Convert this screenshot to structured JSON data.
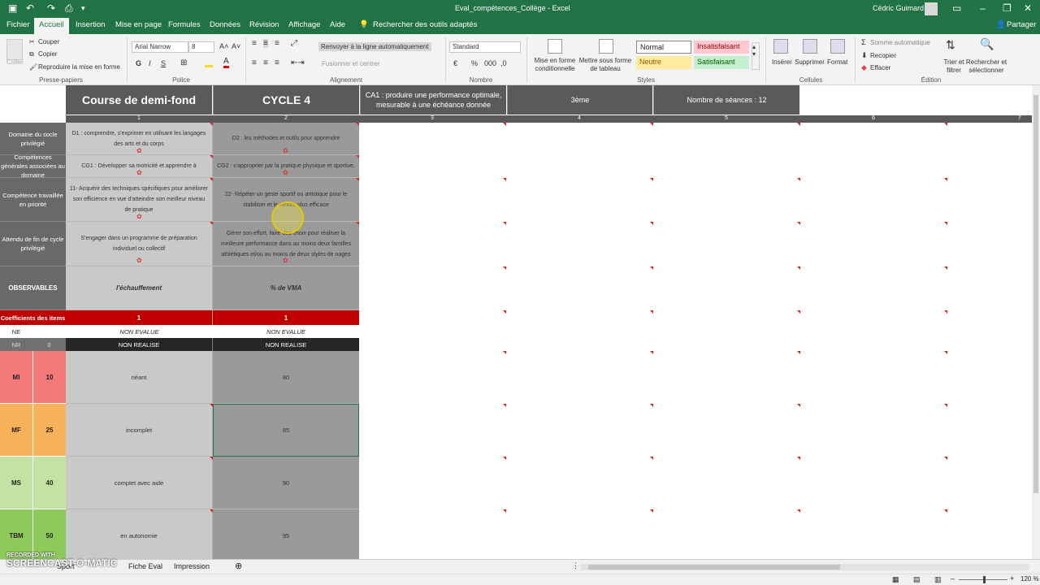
{
  "window": {
    "title": "Eval_compétences_Collège - Excel",
    "user": "Cédric Guimard"
  },
  "tabs": [
    "Fichier",
    "Accueil",
    "Insertion",
    "Mise en page",
    "Formules",
    "Données",
    "Révision",
    "Affichage",
    "Aide"
  ],
  "tell_me": "Rechercher des outils adaptés",
  "share": "Partager",
  "ribbon": {
    "clipboard": {
      "cut": "Couper",
      "copy": "Copier",
      "paste": "Coller",
      "format_painter": "Reproduire la mise en forme",
      "label": "Presse-papiers"
    },
    "font": {
      "name": "Arial Narrow",
      "size": "8",
      "bold": "G",
      "italic": "I",
      "underline": "S",
      "label": "Police"
    },
    "alignment": {
      "wrap": "Renvoyer à la ligne automatiquement",
      "merge": "Fusionner et centrer",
      "label": "Alignement"
    },
    "number": {
      "format": "Standard",
      "label": "Nombre"
    },
    "styles": {
      "cond": "Mise en forme conditionnelle",
      "table": "Mettre sous forme de tableau",
      "normal": "Normal",
      "bad": "Insatisfaisant",
      "neutral": "Neutre",
      "good": "Satisfaisant",
      "label": "Styles"
    },
    "cells": {
      "insert": "Insérer",
      "delete": "Supprimer",
      "format": "Format",
      "label": "Cellules"
    },
    "editing": {
      "autosum": "Somme automatique",
      "fill": "Recopier",
      "clear": "Effacer",
      "sort": "Trier et filtrer",
      "find": "Rechercher et sélectionner",
      "label": "Édition"
    }
  },
  "sheet": {
    "header": {
      "course": "Course de demi-fond",
      "cycle": "CYCLE 4",
      "ca": "CA1 : produire une performance optimale, mesurable à une échéance donnée",
      "level": "3ème",
      "sessions": "Nombre de séances : 12"
    },
    "col_numbers": [
      "1",
      "2",
      "3",
      "4",
      "5",
      "6",
      "7"
    ],
    "rows": [
      {
        "label": "Domaine du socle privilégié",
        "c1": "D1 : comprendre, s'exprimer en utilisant les langages des arts et du corps",
        "c2": "D2 : les méthodes et outils pour apprendre"
      },
      {
        "label": "Compétences générales associées au domaine",
        "c1": "CG1 : Développer sa motricité et apprendre à",
        "c2": "CG2 : s'approprier par la pratique physique et sportive,"
      },
      {
        "label": "Compétence travaillée en priorité",
        "c1": "11- Acquérir des techniques spécifiques pour améliorer son efficience en vue d'atteindre son meilleur niveau de pratique",
        "c2": "22- Répéter un geste sportif ou artistique pour le stabiliser et le rendre plus efficace"
      },
      {
        "label": "Attendu de fin de cycle privilégié",
        "c1": "S'engager dans un programme de préparation individuel ou collectif",
        "c2": "Gérer son effort, faire des choix pour réaliser la meilleure performance dans au moins deux familles athlétiques et/ou au moins de deux styles de nages"
      },
      {
        "label": "OBSERVABLES",
        "c1": "l'échauffement",
        "c2": "% de VMA"
      }
    ],
    "coef": {
      "label": "Coefficients des items",
      "c1": "1",
      "c2": "1"
    },
    "ne": {
      "label": "NE",
      "c1": "NON EVALUE",
      "c2": "NON EVALUE"
    },
    "nr": {
      "label": "NR",
      "pts": "0",
      "c1": "NON REALISE",
      "c2": "NON REALISE"
    },
    "levels": [
      {
        "code": "MI",
        "pts": "10",
        "c1": "néant",
        "c2": "80",
        "color": "#f47a7a"
      },
      {
        "code": "MF",
        "pts": "25",
        "c1": "incomplet",
        "c2": "85",
        "color": "#f7b25a"
      },
      {
        "code": "MS",
        "pts": "40",
        "c1": "complet avec aide",
        "c2": "90",
        "color": "#c4e2a4"
      },
      {
        "code": "TBM",
        "pts": "50",
        "c1": "en autonomie",
        "c2": "95",
        "color": "#8ec95c"
      }
    ]
  },
  "sheet_tabs": [
    "Sport",
    "Fiche Eval",
    "Impression"
  ],
  "watermark": {
    "line1": "RECORDED WITH",
    "line2": "SCREENCAST-O-MATIC"
  },
  "zoom": "120 %"
}
